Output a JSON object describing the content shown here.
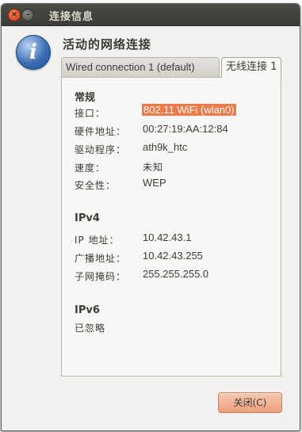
{
  "window": {
    "title": "连接信息"
  },
  "header": {
    "heading": "活动的网络连接"
  },
  "tabs": [
    {
      "label": "Wired connection 1 (default)",
      "active": false
    },
    {
      "label": "无线连接 1",
      "active": true
    }
  ],
  "general": {
    "title": "常规",
    "rows": [
      {
        "label": "接口：",
        "value": "802.11 WiFi (wlan0)",
        "selected": true
      },
      {
        "label": "硬件地址：",
        "value": "00:27:19:AA:12:84"
      },
      {
        "label": "驱动程序：",
        "value": "ath9k_htc"
      },
      {
        "label": "速度：",
        "value": "未知"
      },
      {
        "label": "安全性：",
        "value": "WEP"
      }
    ]
  },
  "ipv4": {
    "title": "IPv4",
    "rows": [
      {
        "label": "IP 地址：",
        "value": "10.42.43.1"
      },
      {
        "label": "广播地址：",
        "value": "10.42.43.255"
      },
      {
        "label": "子网掩码：",
        "value": "255.255.255.0"
      }
    ]
  },
  "ipv6": {
    "title": "IPv6",
    "status": "已忽略"
  },
  "buttons": {
    "close_label": "关闭(C)"
  },
  "icons": {
    "close": "close-icon",
    "minimize": "minimize-icon",
    "info": "info-icon"
  },
  "colors": {
    "selection": "#f07746",
    "titlebar": "#3c3b37",
    "button": "#eca07c"
  }
}
